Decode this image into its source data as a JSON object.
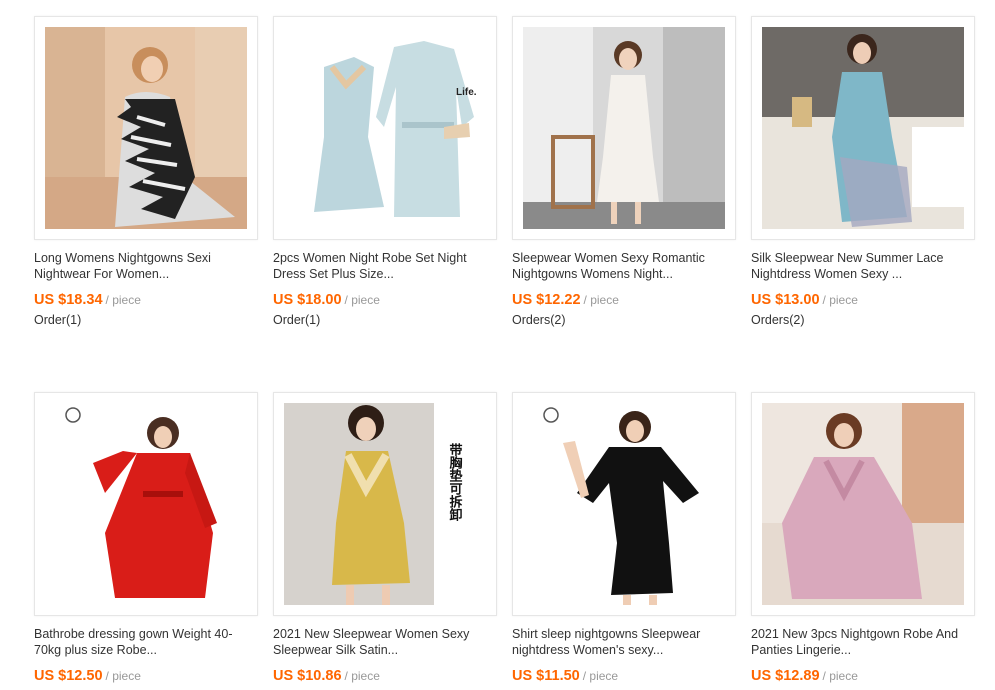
{
  "products": [
    {
      "title": "Long Womens Nightgowns Sexi Nightwear For Women...",
      "price": "US $18.34",
      "unit": "/ piece",
      "orders": "Order(1)"
    },
    {
      "title": "2pcs Women Night Robe Set Night Dress Set Plus Size...",
      "price": "US $18.00",
      "unit": "/ piece",
      "orders": "Order(1)",
      "image_text": "Life."
    },
    {
      "title": "Sleepwear Women Sexy Romantic Nightgowns Womens Night...",
      "price": "US $12.22",
      "unit": "/ piece",
      "orders": "Orders(2)"
    },
    {
      "title": "Silk Sleepwear New Summer Lace Nightdress Women Sexy ...",
      "price": "US $13.00",
      "unit": "/ piece",
      "orders": "Orders(2)"
    },
    {
      "title": "Bathrobe dressing gown Weight 40-70kg plus size Robe...",
      "price": "US $12.50",
      "unit": "/ piece",
      "orders": ""
    },
    {
      "title": "2021 New Sleepwear Women Sexy Sleepwear Silk Satin...",
      "price": "US $10.86",
      "unit": "/ piece",
      "orders": "",
      "image_text": "带胸垫可拆卸"
    },
    {
      "title": "Shirt sleep nightgowns Sleepwear nightdress Women's sexy...",
      "price": "US $11.50",
      "unit": "/ piece",
      "orders": ""
    },
    {
      "title": "2021 New 3pcs Nightgown Robe And Panties Lingerie...",
      "price": "US $12.89",
      "unit": "/ piece",
      "orders": ""
    }
  ],
  "colors": {
    "price": "#ff6600",
    "unit": "#999999",
    "border": "#e6e6e6"
  }
}
